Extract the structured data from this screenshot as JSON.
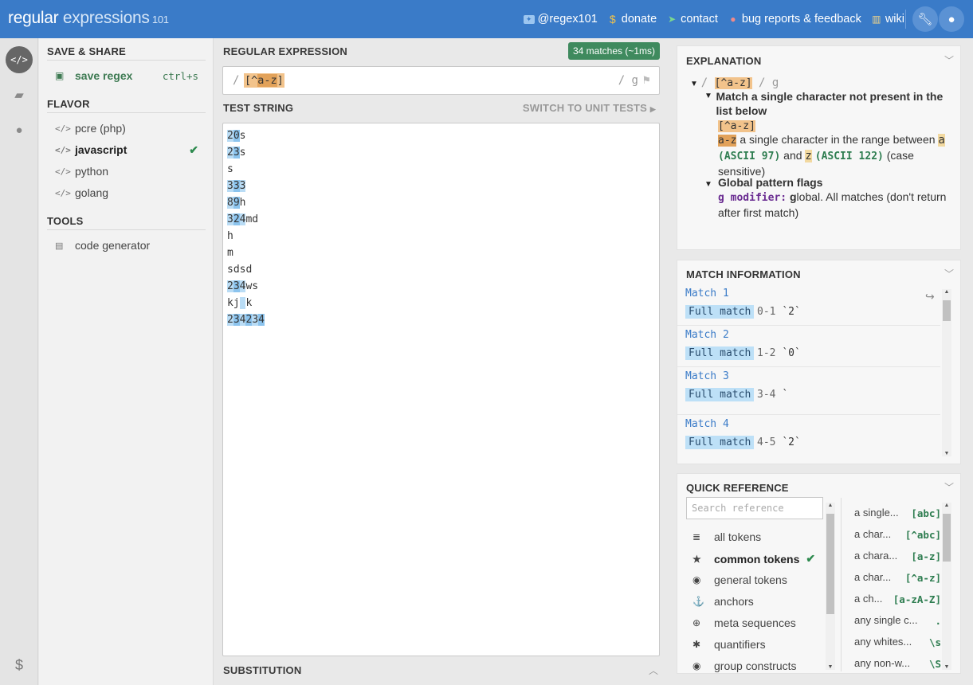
{
  "header": {
    "brand_part1": "regular ",
    "brand_part2": "expressions",
    "brand_part3": " 101",
    "links": [
      {
        "label": "@regex101",
        "icon": "twitter-icon"
      },
      {
        "label": "donate",
        "icon": "dollar-icon"
      },
      {
        "label": "contact",
        "icon": "send-icon"
      },
      {
        "label": "bug reports & feedback",
        "icon": "github-icon"
      },
      {
        "label": "wiki",
        "icon": "bank-icon"
      }
    ]
  },
  "sidebar": {
    "save_share_title": "SAVE & SHARE",
    "save_label": "save regex",
    "save_shortcut": "ctrl+s",
    "flavor_title": "FLAVOR",
    "flavors": [
      {
        "label": "pcre (php)",
        "selected": false
      },
      {
        "label": "javascript",
        "selected": true
      },
      {
        "label": "python",
        "selected": false
      },
      {
        "label": "golang",
        "selected": false
      }
    ],
    "tools_title": "TOOLS",
    "tools": [
      {
        "label": "code generator"
      }
    ]
  },
  "regex": {
    "title": "REGULAR EXPRESSION",
    "match_badge": "34 matches (~1ms)",
    "open_delim": "/",
    "tok_open": "[^",
    "tok_range": "a-z",
    "tok_close": "]",
    "flags": "/ g"
  },
  "test": {
    "title": "TEST STRING",
    "switch_label": "SWITCH TO UNIT TESTS",
    "lines": [
      [
        {
          "t": "2",
          "m": 1
        },
        {
          "t": "0",
          "m": 2
        },
        {
          "t": "s",
          "m": 0
        }
      ],
      [
        {
          "t": "2",
          "m": 1
        },
        {
          "t": "3",
          "m": 2
        },
        {
          "t": "s",
          "m": 0
        }
      ],
      [
        {
          "t": "s",
          "m": 0
        }
      ],
      [
        {
          "t": "3",
          "m": 1
        },
        {
          "t": "3",
          "m": 2
        },
        {
          "t": "3",
          "m": 1
        }
      ],
      [
        {
          "t": "8",
          "m": 1
        },
        {
          "t": "9",
          "m": 2
        },
        {
          "t": "h",
          "m": 0
        }
      ],
      [
        {
          "t": "3",
          "m": 1
        },
        {
          "t": "2",
          "m": 2
        },
        {
          "t": "4",
          "m": 1
        },
        {
          "t": "md",
          "m": 0
        }
      ],
      [
        {
          "t": "h",
          "m": 0
        }
      ],
      [
        {
          "t": "m",
          "m": 0
        }
      ],
      [
        {
          "t": "sdsd",
          "m": 0
        }
      ],
      [
        {
          "t": "2",
          "m": 1
        },
        {
          "t": "3",
          "m": 2
        },
        {
          "t": "4",
          "m": 1
        },
        {
          "t": "ws",
          "m": 0
        }
      ],
      [
        {
          "t": "kj",
          "m": 0
        },
        {
          "t": " ",
          "m": 1
        },
        {
          "t": "k",
          "m": 0
        }
      ],
      [
        {
          "t": "2",
          "m": 1
        },
        {
          "t": "3",
          "m": 2
        },
        {
          "t": "4",
          "m": 1
        },
        {
          "t": "2",
          "m": 2
        },
        {
          "t": "3",
          "m": 1
        },
        {
          "t": "4",
          "m": 2
        }
      ]
    ]
  },
  "substitution": {
    "title": "SUBSTITUTION"
  },
  "explanation": {
    "title": "EXPLANATION",
    "root_prefix": "/ ",
    "root_token": "[^a-z]",
    "root_suffix": " / g",
    "item1_title": "Match a single character not present in the list below",
    "item1_token": "[^a-z]",
    "item1_range_token": "a-z",
    "item1_text1": " a single character in the range between ",
    "item1_a": "a",
    "item1_ascii1": "(ASCII 97)",
    "item1_and": " and ",
    "item1_z": "z",
    "item1_ascii2": "(ASCII 122)",
    "item1_tail": " (case sensitive)",
    "item2_title": "Global pattern flags",
    "item2_mod": "g modifier:",
    "item2_g": "g",
    "item2_text": "lobal. All matches (don't return after first match)"
  },
  "match_info": {
    "title": "MATCH INFORMATION",
    "matches": [
      {
        "name": "Match 1",
        "label": "Full match",
        "range": "0-1",
        "value": "`2`"
      },
      {
        "name": "Match 2",
        "label": "Full match",
        "range": "1-2",
        "value": "`0`"
      },
      {
        "name": "Match 3",
        "label": "Full match",
        "range": "3-4",
        "value": "`"
      },
      {
        "name": "Match 4",
        "label": "Full match",
        "range": "4-5",
        "value": "`2`"
      }
    ]
  },
  "quick_ref": {
    "title": "QUICK REFERENCE",
    "search_placeholder": "Search reference",
    "categories": [
      {
        "label": "all tokens",
        "icon": "database-icon",
        "selected": false
      },
      {
        "label": "common tokens",
        "icon": "star-icon",
        "selected": true
      },
      {
        "label": "general tokens",
        "icon": "target-icon",
        "selected": false
      },
      {
        "label": "anchors",
        "icon": "anchor-icon",
        "selected": false
      },
      {
        "label": "meta sequences",
        "icon": "lifebuoy-icon",
        "selected": false
      },
      {
        "label": "quantifiers",
        "icon": "asterisk-icon",
        "selected": false
      },
      {
        "label": "group constructs",
        "icon": "target-icon",
        "selected": false
      }
    ],
    "items": [
      {
        "desc": "a single...",
        "token": "[abc]"
      },
      {
        "desc": "a char...",
        "token": "[^abc]"
      },
      {
        "desc": "a chara...",
        "token": "[a-z]"
      },
      {
        "desc": "a char...",
        "token": "[^a-z]"
      },
      {
        "desc": "a ch...",
        "token": "[a-zA-Z]"
      },
      {
        "desc": "any single c...",
        "token": "."
      },
      {
        "desc": "any whites...",
        "token": "\\s"
      },
      {
        "desc": "any non-w...",
        "token": "\\S"
      }
    ]
  }
}
